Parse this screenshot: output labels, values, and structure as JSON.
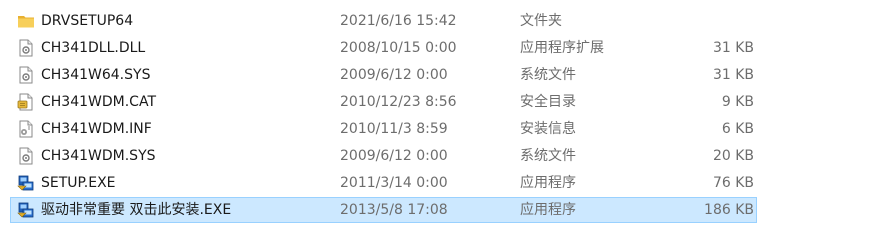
{
  "files": [
    {
      "name": "DRVSETUP64",
      "date": "2021/6/16 15:42",
      "type": "文件夹",
      "size": "",
      "icon": "folder-icon",
      "selected": false
    },
    {
      "name": "CH341DLL.DLL",
      "date": "2008/10/15 0:00",
      "type": "应用程序扩展",
      "size": "31 KB",
      "icon": "dll-file-icon",
      "selected": false
    },
    {
      "name": "CH341W64.SYS",
      "date": "2009/6/12 0:00",
      "type": "系统文件",
      "size": "31 KB",
      "icon": "sys-file-icon",
      "selected": false
    },
    {
      "name": "CH341WDM.CAT",
      "date": "2010/12/23 8:56",
      "type": "安全目录",
      "size": "9 KB",
      "icon": "cat-file-icon",
      "selected": false
    },
    {
      "name": "CH341WDM.INF",
      "date": "2010/11/3 8:59",
      "type": "安装信息",
      "size": "6 KB",
      "icon": "inf-file-icon",
      "selected": false
    },
    {
      "name": "CH341WDM.SYS",
      "date": "2009/6/12 0:00",
      "type": "系统文件",
      "size": "20 KB",
      "icon": "sys-file-icon",
      "selected": false
    },
    {
      "name": "SETUP.EXE",
      "date": "2011/3/14 0:00",
      "type": "应用程序",
      "size": "76 KB",
      "icon": "setup-exe-icon",
      "selected": false
    },
    {
      "name": "驱动非常重要 双击此安装.EXE",
      "date": "2013/5/8 17:08",
      "type": "应用程序",
      "size": "186 KB",
      "icon": "setup-exe-icon",
      "selected": true
    }
  ],
  "colors": {
    "selection_bg": "#cce8ff",
    "selection_border": "#99d1ff",
    "folder": "#f3c440",
    "secondary_text": "#6d6d6d"
  }
}
